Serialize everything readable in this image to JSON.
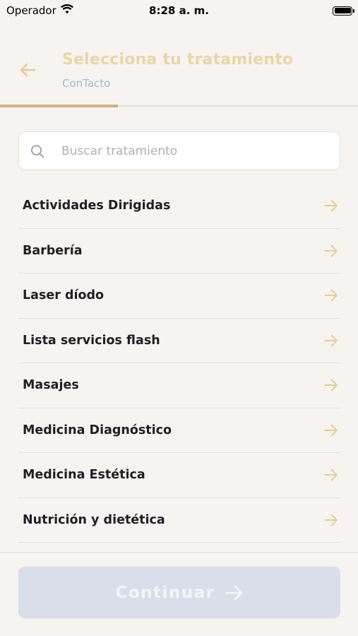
{
  "status_bar": {
    "carrier": "Operador",
    "time": "8:28 a. m."
  },
  "header": {
    "title": "Selecciona tu tratamiento",
    "subtitle": "ConTacto",
    "progress_fraction": 0.33
  },
  "search": {
    "placeholder": "Buscar tratamiento",
    "value": ""
  },
  "treatments": [
    {
      "label": "Actividades Dirigidas"
    },
    {
      "label": "Barbería"
    },
    {
      "label": "Laser díodo"
    },
    {
      "label": "Lista servicios flash"
    },
    {
      "label": "Masajes"
    },
    {
      "label": "Medicina Diagnóstico"
    },
    {
      "label": "Medicina Estética"
    },
    {
      "label": "Nutrición y dietética"
    }
  ],
  "footer": {
    "continue_label": "Continuar"
  },
  "colors": {
    "background": "#f7f3f1",
    "accent_gold": "#d1b27e",
    "title_gold": "#e8d6a8",
    "subtitle_blue": "#a7b6cf",
    "button_disabled": "#d8dfea"
  }
}
